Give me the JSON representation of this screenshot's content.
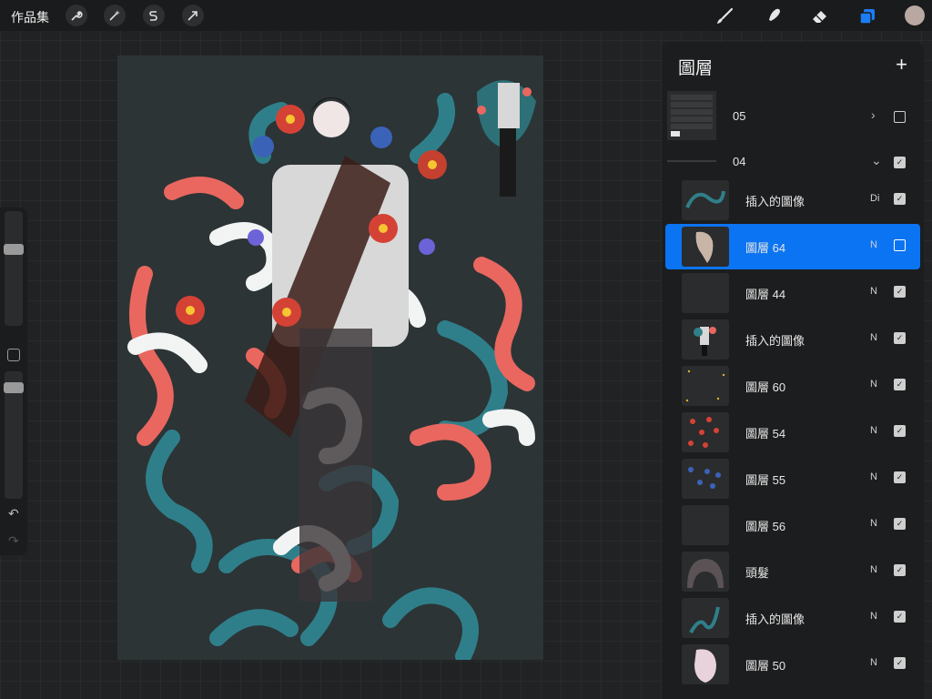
{
  "toolbar": {
    "gallery": "作品集",
    "icons": [
      "wrench-icon",
      "magic-wand-icon",
      "selection-s-icon",
      "transform-arrow-icon",
      "brush-icon",
      "smudge-icon",
      "eraser-icon",
      "layers-icon"
    ]
  },
  "layers": {
    "title": "圖層",
    "add": "+",
    "items": [
      {
        "name": "05",
        "type": "group",
        "expanded": false,
        "visible": false
      },
      {
        "name": "04",
        "type": "group",
        "expanded": true,
        "visible": true
      },
      {
        "name": "插入的圖像",
        "mode": "Di",
        "visible": true
      },
      {
        "name": "圖層 64",
        "mode": "N",
        "visible": false,
        "selected": true
      },
      {
        "name": "圖層 44",
        "mode": "N",
        "visible": true
      },
      {
        "name": "插入的圖像",
        "mode": "N",
        "visible": true
      },
      {
        "name": "圖層 60",
        "mode": "N",
        "visible": true
      },
      {
        "name": "圖層 54",
        "mode": "N",
        "visible": true
      },
      {
        "name": "圖層 55",
        "mode": "N",
        "visible": true
      },
      {
        "name": "圖層 56",
        "mode": "N",
        "visible": true
      },
      {
        "name": "頭髮",
        "mode": "N",
        "visible": true
      },
      {
        "name": "插入的圖像",
        "mode": "N",
        "visible": true
      },
      {
        "name": "圖層 50",
        "mode": "N",
        "visible": true
      }
    ]
  },
  "colors": {
    "accent": "#0b74f2",
    "coral": "#e9675f",
    "teal": "#2f7f8a",
    "canvas": "#2c3436"
  }
}
